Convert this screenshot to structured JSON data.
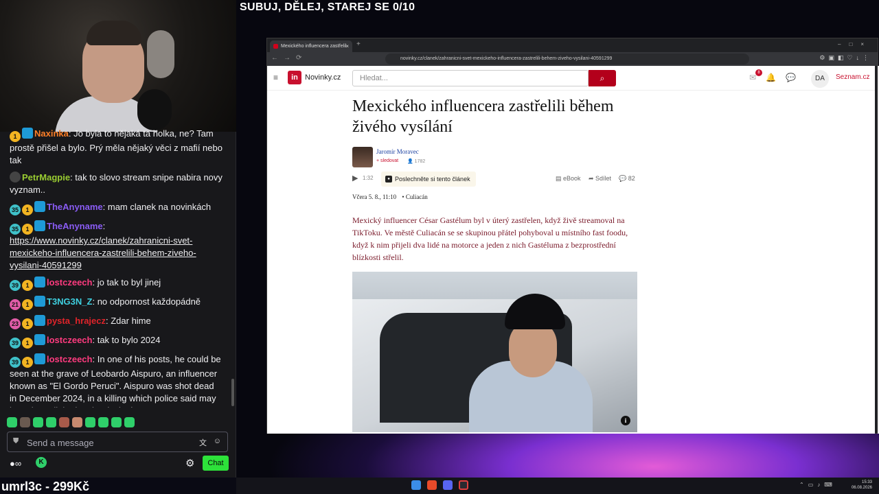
{
  "overlay": {
    "title": "SUBUJ, DĚLEJ, STAREJ SE 0/10",
    "price_banner": "umrl3c - 299Kč"
  },
  "chat": {
    "messages": [
      {
        "badges": [
          "1"
        ],
        "user": "Naxinka",
        "user_color": "#ff7f27",
        "text": ": Jo byla to nějaká ta holka, ne? Tam prostě přišel a bylo. Prý měla nějaký věci z mafií nebo tak"
      },
      {
        "badges": [],
        "user": "PetrMagpie",
        "user_color": "#9acd32",
        "text": ": tak to slovo stream snipe nabira novy vyznam.."
      },
      {
        "badges": [
          "35",
          "1"
        ],
        "user": "TheAnyname",
        "user_color": "#8a5cf5",
        "text": ": mam clanek na novinkách"
      },
      {
        "badges": [
          "35",
          "1"
        ],
        "user": "TheAnyname",
        "user_color": "#8a5cf5",
        "text": ":",
        "link": "https://www.novinky.cz/clanek/zahranicni-svet-mexickeho-influencera-zastrelili-behem-ziveho-vysilani-40591299"
      },
      {
        "badges": [
          "39",
          "1"
        ],
        "user": "lostczeech",
        "user_color": "#ff3b7f",
        "text": ": jo tak to byl jinej"
      },
      {
        "badges": [
          "21",
          "1"
        ],
        "user": "T3NG3N_Z",
        "user_color": "#3fd0e0",
        "text": ": no odpornost každopádně"
      },
      {
        "badges": [
          "23",
          "1"
        ],
        "user": "pysta_hrajecz",
        "user_color": "#e0242a",
        "text": ": Zdar hime"
      },
      {
        "badges": [
          "39",
          "1"
        ],
        "user": "lostczeech",
        "user_color": "#ff3b7f",
        "text": ": tak to bylo 2024"
      },
      {
        "badges": [
          "39",
          "1"
        ],
        "user": "lostczeech",
        "user_color": "#ff3b7f",
        "text": ": In one of his posts, he could be seen at the grave of Leobardo Aispuro, an influencer known as \"El Gordo Peruci\". Aispuro was shot dead in December 2024, in a killing which police said may have been linked to the rivalry between two"
      }
    ],
    "input_placeholder": "Send a message",
    "points_symbol": "∞",
    "chat_button": "Chat"
  },
  "browser": {
    "tab_title": "Mexického influencera zastřelil",
    "url": "novinky.cz/clanek/zahranicni-svet-mexickeho-influencera-zastrelili-behem-ziveho-vysilani-40591299",
    "site": {
      "logo_mark": "in",
      "logo_text": "Novinky.cz",
      "search_placeholder": "Hledat...",
      "notif_count": "8",
      "avatar_initials": "DA",
      "seznam": "Seznam.cz"
    },
    "article": {
      "headline": "Mexického influencera zastřelili během živého vysílání",
      "author": "Jaromír Moravec",
      "follow": "+ sledovat",
      "followers": "1782",
      "duration": "1:32",
      "listen": "Poslechněte si tento článek",
      "ebook": "eBook",
      "share": "Sdílet",
      "comments": "82",
      "date": "Včera 5. 8., 11:10",
      "place": "Culiacán",
      "perex": "Mexický influencer César Gastélum byl v úterý zastřelen, když živě streamoval na TikToku. Ve městě Culiacán se se skupinou přátel pohyboval u místního fast foodu, když k nim přijeli dva lidé na motorce a jeden z nich Gastéluma z bezprostřední blízkosti střelil.",
      "photo_info": "i"
    }
  },
  "taskbar": {
    "time": "15:33",
    "date": "06.08.2026"
  }
}
